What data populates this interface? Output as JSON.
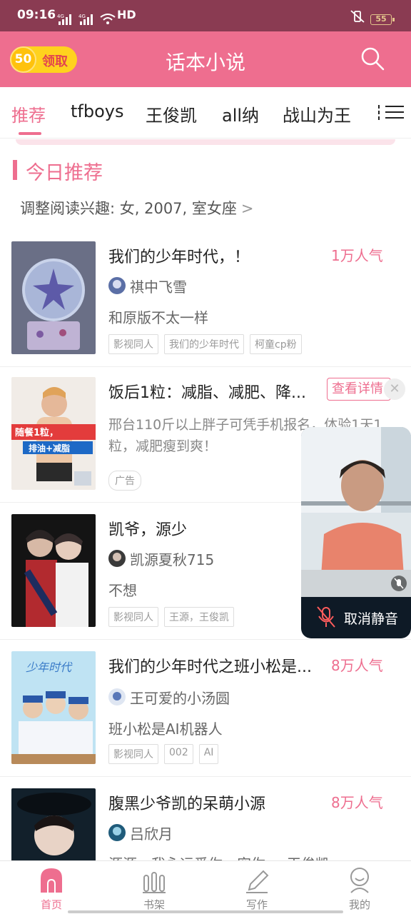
{
  "status_bar": {
    "time": "09:16",
    "network": "HD",
    "battery": "55"
  },
  "header": {
    "coin_value": "50",
    "coin_label": "领取",
    "title": "话本小说"
  },
  "tabs": [
    {
      "label": "推荐"
    },
    {
      "label": "tfboys"
    },
    {
      "label": "王俊凯"
    },
    {
      "label": "all纳"
    },
    {
      "label": "战山为王"
    }
  ],
  "section": {
    "title": "今日推荐",
    "interest": "调整阅读兴趣: 女, 2007, 室女座"
  },
  "books": [
    {
      "title": "我们的少年时代，！",
      "popularity": "1万人气",
      "author": "祺中飞雪",
      "desc": "和原版不太一样",
      "tags": [
        "影视同人",
        "我们的少年时代",
        "柯童cp粉"
      ]
    },
    {
      "title": "凯爷，源少",
      "popularity": "",
      "author": "凯源夏秋715",
      "desc": "不想",
      "tags": [
        "影视同人",
        "王源，王俊凯"
      ]
    },
    {
      "title": "我们的少年时代之班小松是...",
      "popularity": "8万人气",
      "author": "王可爱的小汤圆",
      "desc": "班小松是AI机器人",
      "tags": [
        "影视同人",
        "002",
        "AI"
      ]
    },
    {
      "title": "腹黑少爷凯的呆萌小源",
      "popularity": "8万人气",
      "author": "吕欣月",
      "desc": "源源，我永远爱你，宠你。。王俊凯",
      "tags": []
    }
  ],
  "ad": {
    "title": "饭后1粒：减脂、减肥、降...",
    "button": "查看详情",
    "desc": "邢台110斤以上胖子可凭手机报名，体验1天1粒，减肥瘦到爽！",
    "tag": "广告",
    "cover_text_1": "随餐1粒，",
    "cover_text_2": "排油+减脂"
  },
  "video_call": {
    "unmute_label": "取消静音"
  },
  "bottom_nav": [
    {
      "label": "首页",
      "icon": "home-icon"
    },
    {
      "label": "书架",
      "icon": "bookshelf-icon"
    },
    {
      "label": "写作",
      "icon": "pen-icon"
    },
    {
      "label": "我的",
      "icon": "profile-icon"
    }
  ],
  "colors": {
    "brand": "#ee6e8f",
    "status_bar": "#8a3b52",
    "coin": "#ffd21e"
  }
}
